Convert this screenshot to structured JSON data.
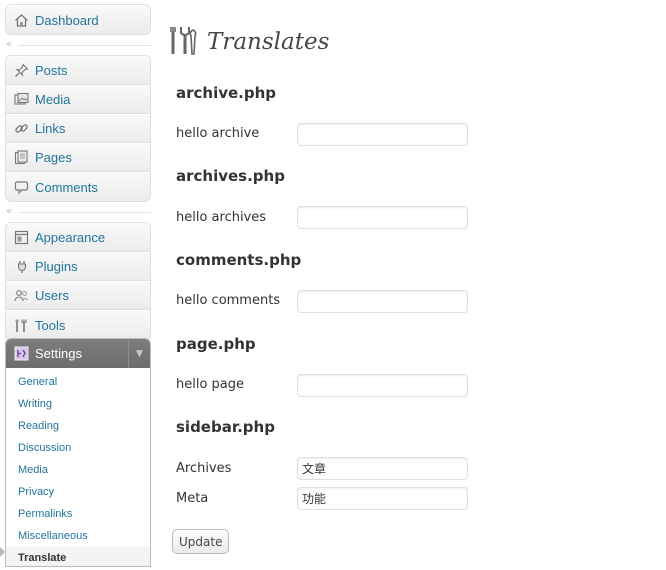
{
  "sidebar": {
    "dashboard": {
      "label": "Dashboard"
    },
    "content_items": [
      {
        "label": "Posts",
        "icon": "pushpin-icon"
      },
      {
        "label": "Media",
        "icon": "media-icon"
      },
      {
        "label": "Links",
        "icon": "chain-link-icon"
      },
      {
        "label": "Pages",
        "icon": "pages-icon"
      },
      {
        "label": "Comments",
        "icon": "speech-bubble-icon"
      }
    ],
    "admin_items": [
      {
        "label": "Appearance",
        "icon": "appearance-icon"
      },
      {
        "label": "Plugins",
        "icon": "plug-icon"
      },
      {
        "label": "Users",
        "icon": "users-icon"
      },
      {
        "label": "Tools",
        "icon": "tools-icon"
      }
    ],
    "settings": {
      "label": "Settings",
      "submenu": [
        "General",
        "Writing",
        "Reading",
        "Discussion",
        "Media",
        "Privacy",
        "Permalinks",
        "Miscellaneous",
        "Translate"
      ],
      "current": "Translate"
    }
  },
  "main": {
    "title": "Translates",
    "sections": [
      {
        "title": "archive.php",
        "rows": [
          {
            "label": "hello archive",
            "value": ""
          }
        ]
      },
      {
        "title": "archives.php",
        "rows": [
          {
            "label": "hello archives",
            "value": ""
          }
        ]
      },
      {
        "title": "comments.php",
        "rows": [
          {
            "label": "hello comments",
            "value": ""
          }
        ]
      },
      {
        "title": "page.php",
        "rows": [
          {
            "label": "hello page",
            "value": ""
          }
        ]
      },
      {
        "title": "sidebar.php",
        "rows": [
          {
            "label": "Archives",
            "value": "文章"
          },
          {
            "label": "Meta",
            "value": "功能"
          }
        ]
      }
    ],
    "update_label": "Update"
  },
  "colors": {
    "link": "#21759b",
    "settings_header": "#767676",
    "text": "#333333"
  }
}
